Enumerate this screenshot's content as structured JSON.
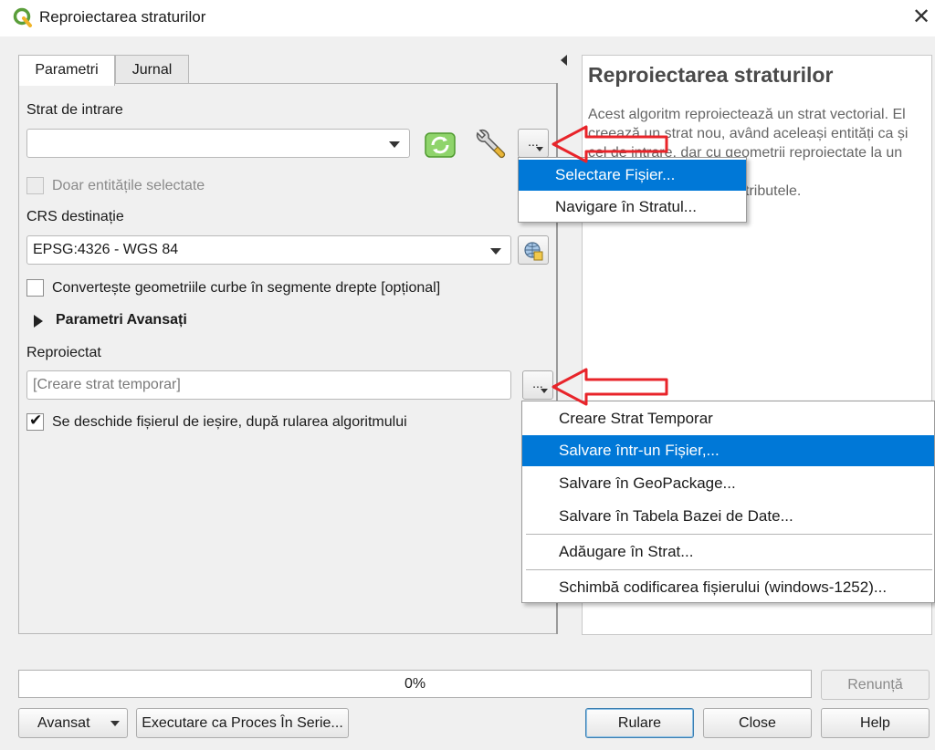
{
  "window": {
    "title": "Reproiectarea straturilor"
  },
  "tabs": [
    {
      "label": "Parametri"
    },
    {
      "label": "Jurnal"
    }
  ],
  "params": {
    "input_layer_label": "Strat de intrare",
    "input_layer_value": "",
    "selected_only_label": "Doar entitățile selectate",
    "crs_label": "CRS destinație",
    "crs_value": "EPSG:4326 - WGS 84",
    "convert_curves_label": "Convertește geometriile curbe în segmente drepte [opțional]",
    "advanced_label": "Parametri Avansați",
    "output_label": "Reproiectat",
    "output_placeholder": "[Creare strat temporar]",
    "open_output_label": "Se deschide fișierul de ieșire, după rularea algoritmului",
    "ellipsis": "..."
  },
  "input_menu": {
    "items": [
      {
        "label": "Selectare Fișier..."
      },
      {
        "label": "Navigare în Stratul..."
      }
    ]
  },
  "output_menu": {
    "items": [
      {
        "label": "Creare Strat Temporar"
      },
      {
        "label": "Salvare într-un Fișier,..."
      },
      {
        "label": "Salvare în GeoPackage..."
      },
      {
        "label": "Salvare în Tabela Bazei de Date..."
      },
      {
        "label": "Adăugare în Strat..."
      },
      {
        "label": "Schimbă codificarea fișierului (windows-1252)..."
      }
    ]
  },
  "help": {
    "title": "Reproiectarea straturilor",
    "lines": [
      "Acest algoritm reproiectează un strat vectorial. El",
      "creează un strat nou, având aceleași entități ca și",
      "cel de intrare, dar cu geometrii reproiectate la un",
      "",
      "tributele."
    ]
  },
  "footer": {
    "progress_text": "0%",
    "progress_value": 0,
    "cancel": "Renunță",
    "advanced": "Avansat",
    "batch": "Executare ca Proces În Serie...",
    "run": "Rulare",
    "close": "Close",
    "help": "Help"
  },
  "colors": {
    "highlight": "#0078d7",
    "arrow": "#e8242a",
    "qgis_green": "#5a9e3a"
  }
}
